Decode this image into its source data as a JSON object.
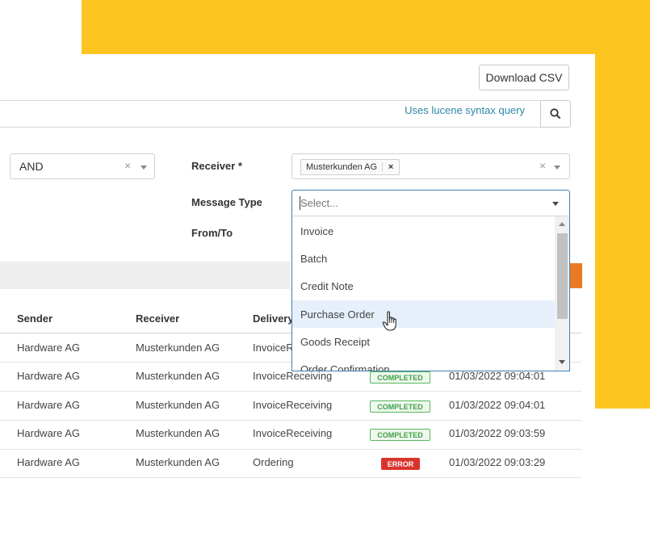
{
  "toolbar": {
    "download_csv_label": "Download CSV"
  },
  "search": {
    "hint": "Uses lucene syntax query",
    "icon": "search-icon"
  },
  "filters": {
    "operator": {
      "value": "AND"
    },
    "receiver": {
      "label": "Receiver *",
      "tag": "Musterkunden AG",
      "tag_remove": "×"
    },
    "message_type": {
      "label": "Message Type",
      "placeholder": "Select..."
    },
    "from_to": {
      "label": "From/To"
    },
    "clear_symbol": "×"
  },
  "dropdown": {
    "options": [
      "Invoice",
      "Batch",
      "Credit Note",
      "Purchase Order",
      "Goods Receipt",
      "Order Confirmation"
    ],
    "highlighted": "Purchase Order"
  },
  "table": {
    "columns": [
      "Sender",
      "Receiver",
      "Delivery"
    ],
    "rows": [
      {
        "sender": "Hardware AG",
        "receiver": "Musterkunden AG",
        "delivery": "InvoiceR",
        "status": "",
        "time": ""
      },
      {
        "sender": "Hardware AG",
        "receiver": "Musterkunden AG",
        "delivery": "InvoiceReceiving",
        "status": "COMPLETED",
        "time": "01/03/2022 09:04:01"
      },
      {
        "sender": "Hardware AG",
        "receiver": "Musterkunden AG",
        "delivery": "InvoiceReceiving",
        "status": "COMPLETED",
        "time": "01/03/2022 09:04:01"
      },
      {
        "sender": "Hardware AG",
        "receiver": "Musterkunden AG",
        "delivery": "InvoiceReceiving",
        "status": "COMPLETED",
        "time": "01/03/2022 09:03:59"
      },
      {
        "sender": "Hardware AG",
        "receiver": "Musterkunden AG",
        "delivery": "Ordering",
        "status": "ERROR",
        "time": "01/03/2022 09:03:29"
      }
    ]
  },
  "colors": {
    "accent_yellow": "#fcc520",
    "link_blue": "#2e86a8",
    "status_completed": "#43a047",
    "status_error": "#d9342c",
    "orange_button": "#ea7b26",
    "highlight_row": "#e6f0fa"
  }
}
